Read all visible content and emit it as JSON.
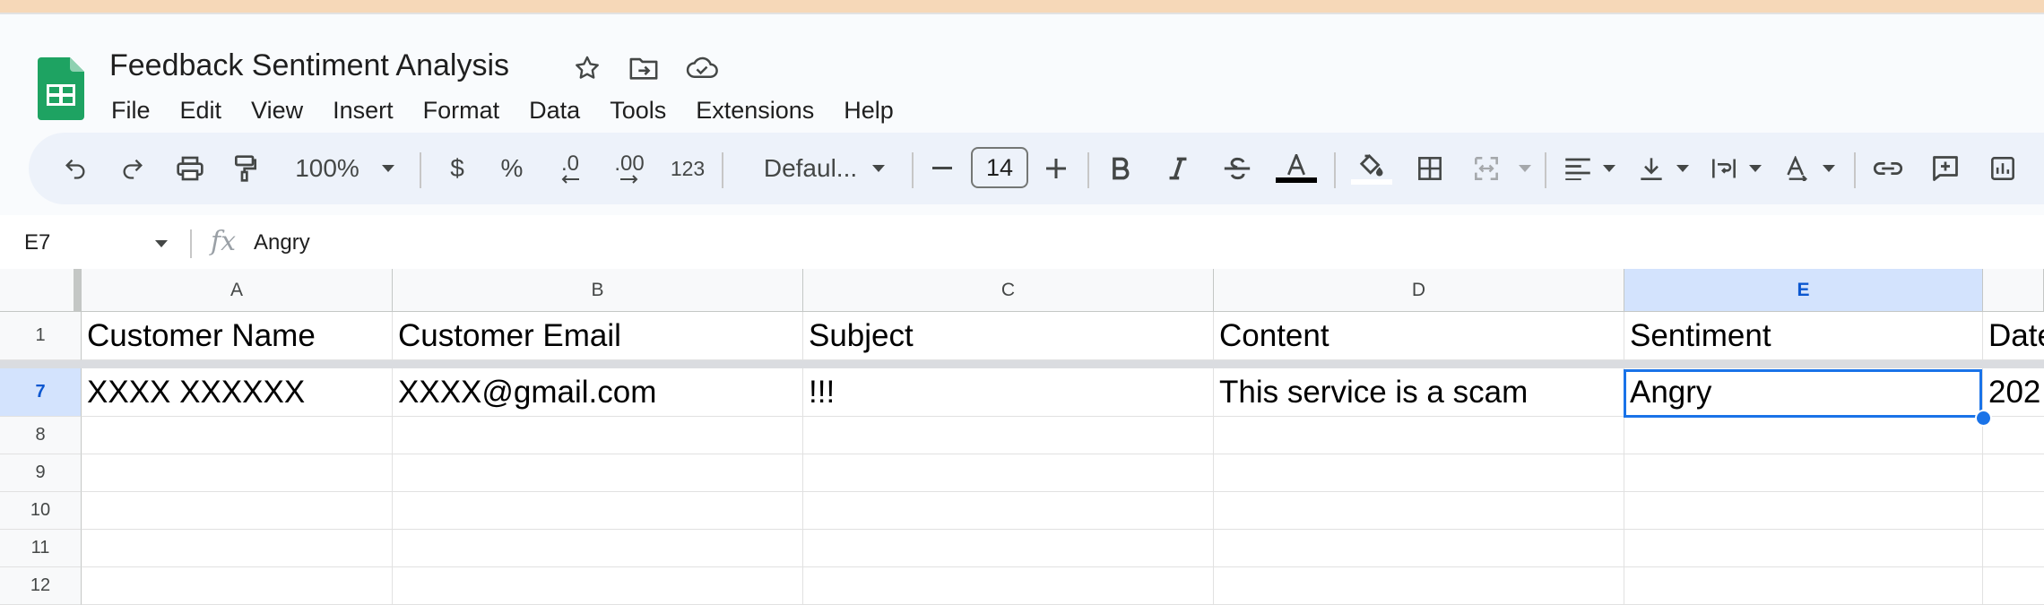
{
  "app": {
    "doc_title": "Feedback Sentiment Analysis",
    "logo_icon": "google-sheets-logo",
    "title_icons": [
      "star-icon",
      "move-to-folder-icon",
      "cloud-saved-icon"
    ]
  },
  "menu": [
    "File",
    "Edit",
    "View",
    "Insert",
    "Format",
    "Data",
    "Tools",
    "Extensions",
    "Help"
  ],
  "toolbar": {
    "zoom": "100%",
    "currency": "$",
    "percent": "%",
    "decrease_decimal": ".0",
    "increase_decimal": ".00",
    "number_format": "123",
    "font_family": "Defaul...",
    "font_size": "14",
    "text_color": "#000000"
  },
  "formula_bar": {
    "name_box": "E7",
    "fx_label": "fx",
    "value": "Angry"
  },
  "sheet": {
    "columns": [
      "A",
      "B",
      "C",
      "D",
      "E"
    ],
    "partial_column_header": "",
    "selected_column": "E",
    "row_numbers": [
      "1",
      "7",
      "8",
      "9",
      "10",
      "11",
      "12"
    ],
    "selected_row": "7",
    "header_row": [
      "Customer Name",
      "Customer Email",
      "Subject",
      "Content",
      "Sentiment",
      "Date"
    ],
    "row7": [
      "XXXX XXXXXX",
      "XXXX@gmail.com",
      "!!!",
      "This service is a scam",
      "Angry",
      "202"
    ],
    "active_cell": "E7",
    "accent_color": "#1a73e8"
  }
}
